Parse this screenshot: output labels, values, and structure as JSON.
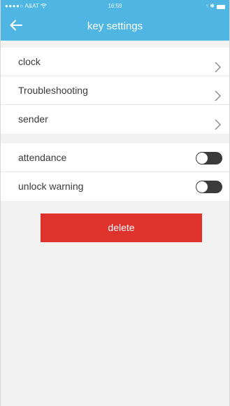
{
  "status_bar": {
    "signal": "●●●●○",
    "carrier": "A&AT",
    "wifi_icon": "wifi-icon",
    "time": "16:59",
    "right_icons": "↑ ✱"
  },
  "nav": {
    "back_icon": "arrow-left-icon",
    "title": "key settings"
  },
  "groups": [
    {
      "rows": [
        {
          "label": "clock",
          "icon": "chevron-right-icon"
        },
        {
          "label": "Troubleshooting",
          "icon": "chevron-right-icon"
        },
        {
          "label": "sender",
          "icon": "chevron-right-icon"
        }
      ]
    },
    {
      "rows": [
        {
          "label": "attendance",
          "toggle": false
        },
        {
          "label": "unlock warning",
          "toggle": false
        }
      ]
    }
  ],
  "delete_button": {
    "label": "delete"
  },
  "colors": {
    "header": "#4fb6e3",
    "delete": "#e0322d",
    "background": "#f2f2f2",
    "toggle_off": "#3b3b3b"
  }
}
